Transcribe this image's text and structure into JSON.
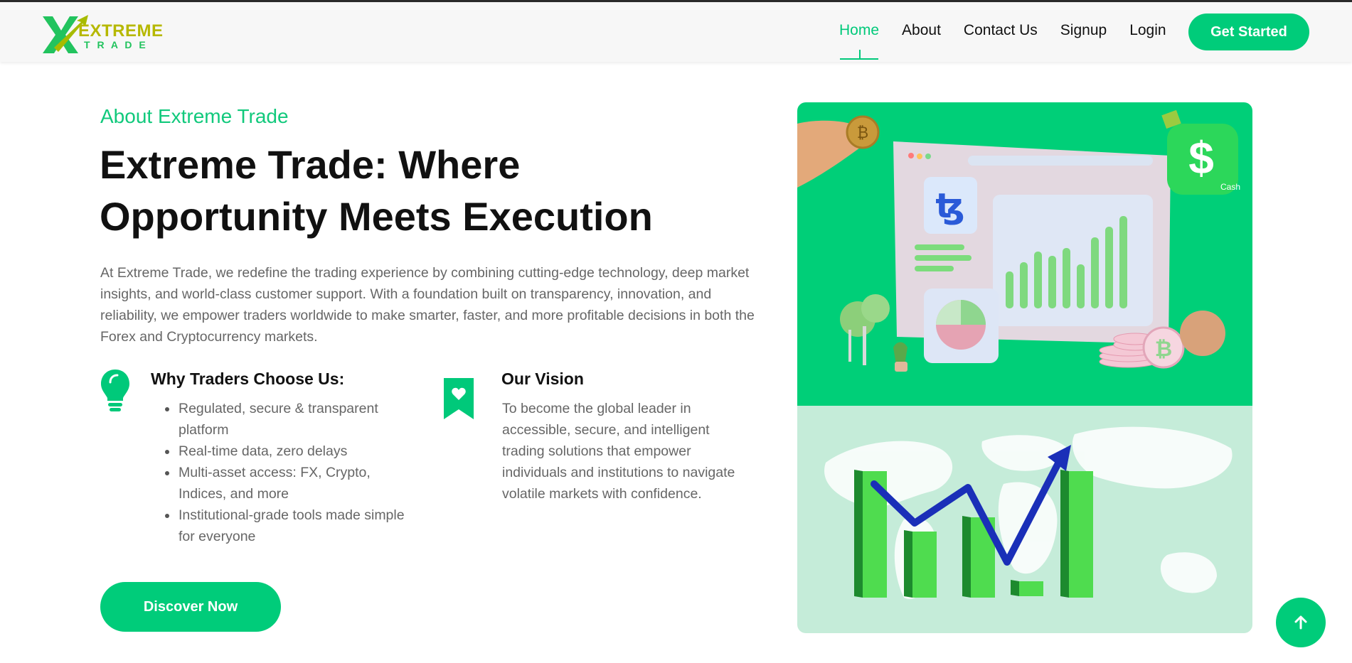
{
  "brand": {
    "logo_line1": "EXTREME",
    "logo_line2": "T R A D E",
    "colors": {
      "accent": "#00cc7a",
      "logo_green": "#22c35e",
      "logo_olive": "#b6b800"
    }
  },
  "nav": {
    "items": [
      {
        "label": "Home",
        "active": true
      },
      {
        "label": "About",
        "active": false
      },
      {
        "label": "Contact Us",
        "active": false
      },
      {
        "label": "Signup",
        "active": false
      },
      {
        "label": "Login",
        "active": false
      }
    ],
    "cta": "Get Started"
  },
  "about": {
    "eyebrow": "About Extreme Trade",
    "title_line1": "Extreme Trade: Where",
    "title_line2": "Opportunity Meets Execution",
    "intro": "At Extreme Trade, we redefine the trading experience by combining cutting-edge technology, deep market insights, and world-class customer support. With a foundation built on transparency, innovation, and reliability, we empower traders worldwide to make smarter, faster, and more profitable decisions in both the Forex and Cryptocurrency markets.",
    "why": {
      "title": "Why Traders Choose Us:",
      "icon": "lightbulb-icon",
      "items": [
        "Regulated, secure & transparent platform",
        "Real-time data, zero delays",
        "Multi-asset access: FX, Crypto, Indices, and more",
        "Institutional-grade tools made simple for everyone"
      ]
    },
    "vision": {
      "title": "Our Vision",
      "icon": "heart-bookmark-icon",
      "text": "To become the global leader in accessible, secure, and intelligent trading solutions that empower individuals and institutions to navigate volatile markets with confidence."
    },
    "cta": "Discover Now"
  },
  "illustration": {
    "cash_app_label": "Cash",
    "dollar_symbol": "$",
    "tezos_symbol": "ꜩ",
    "bitcoin_symbol": "₿"
  },
  "scroll_top": {
    "icon": "arrow-up-icon"
  }
}
